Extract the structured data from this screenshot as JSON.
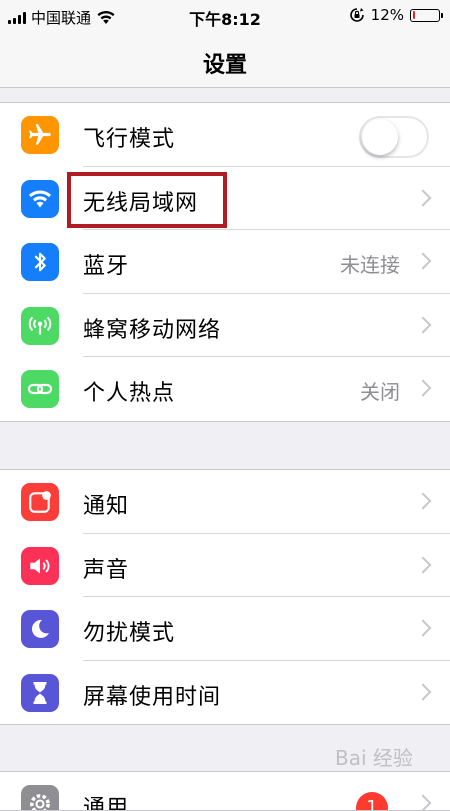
{
  "status_bar": {
    "carrier": "中国联通",
    "time": "下午8:12",
    "battery_percent": "12%",
    "battery_level": 0.12,
    "signal_icon": "cellular-signal-icon",
    "wifi_icon": "wifi-icon",
    "lock_icon": "orientation-lock-icon"
  },
  "nav": {
    "title": "设置"
  },
  "group1": [
    {
      "label": "飞行模式",
      "icon": "airplane-icon",
      "color": "#ff9500",
      "toggle": false
    },
    {
      "label": "无线局域网",
      "icon": "wifi-icon",
      "color": "#157efb"
    },
    {
      "label": "蓝牙",
      "icon": "bluetooth-icon",
      "color": "#157efb",
      "value": "未连接"
    },
    {
      "label": "蜂窝移动网络",
      "icon": "cellular-icon",
      "color": "#4cd964"
    },
    {
      "label": "个人热点",
      "icon": "hotspot-icon",
      "color": "#4cd964",
      "value": "关闭"
    }
  ],
  "group2": [
    {
      "label": "通知",
      "icon": "notifications-icon",
      "color": "#fc3d39"
    },
    {
      "label": "声音",
      "icon": "sound-icon",
      "color": "#fc3158"
    },
    {
      "label": "勿扰模式",
      "icon": "moon-icon",
      "color": "#5856d6"
    },
    {
      "label": "屏幕使用时间",
      "icon": "hourglass-icon",
      "color": "#5856d6"
    }
  ],
  "group3": [
    {
      "label": "通用",
      "icon": "gear-icon",
      "color": "#8e8e93",
      "badge": "1"
    }
  ],
  "watermark": "Bai 经验"
}
